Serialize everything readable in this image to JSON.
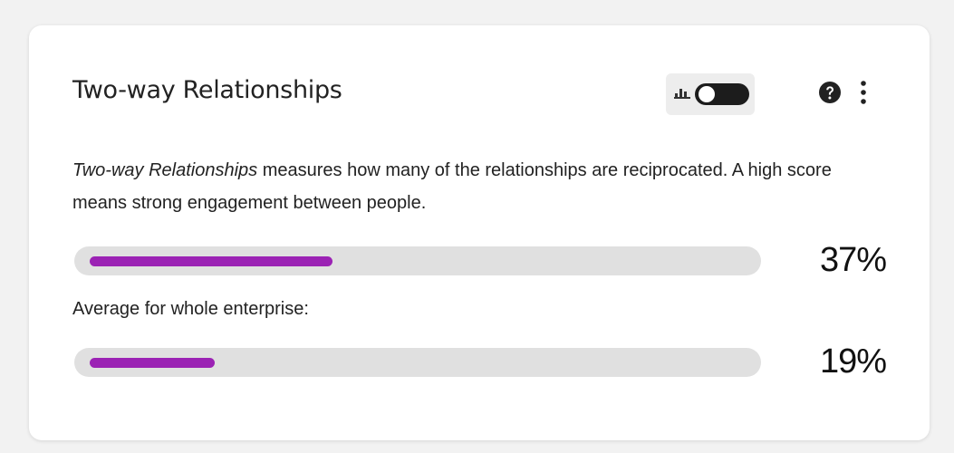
{
  "widget": {
    "title": "Two-way Relationships",
    "toggle_checked": false,
    "description_term": "Two-way Relationships",
    "description_rest": " measures how many of the relationships are reciprocated. A high score means strong engagement between people.",
    "score_value": 37,
    "score_label": "37%",
    "average_label": "Average for whole enterprise:",
    "average_value": 19,
    "average_value_label": "19%"
  },
  "icons": {
    "chart": "bar-chart-icon",
    "help": "help-circle-icon",
    "more": "more-vertical-icon"
  },
  "colors": {
    "accent": "#9b22b4",
    "track": "#e0e0e0",
    "toggle": "#1c1c1c"
  }
}
